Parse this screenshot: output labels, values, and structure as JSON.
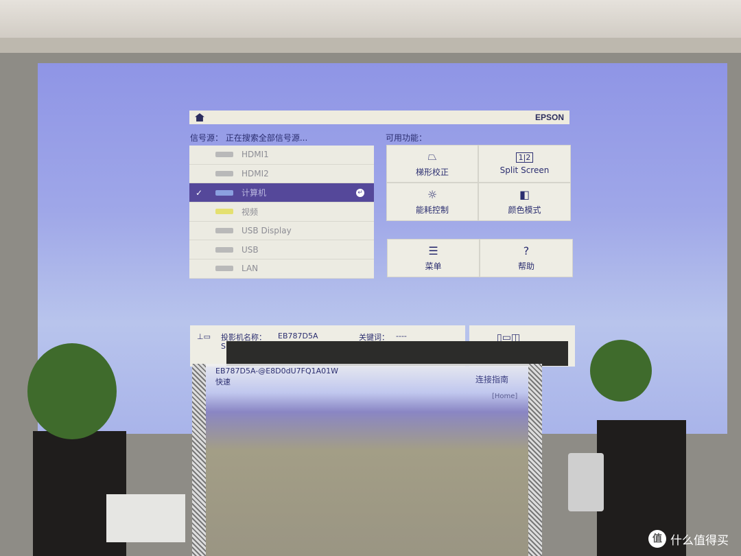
{
  "topbar": {
    "brand": "EPSON",
    "home_icon": "home-icon"
  },
  "source": {
    "header": "信号源： 正在搜索全部信号源...",
    "items": [
      {
        "label": "HDMI1"
      },
      {
        "label": "HDMI2"
      },
      {
        "label": "计算机",
        "selected": true
      },
      {
        "label": "视频"
      },
      {
        "label": "USB Display"
      },
      {
        "label": "USB"
      },
      {
        "label": "LAN"
      }
    ]
  },
  "functions": {
    "header": "可用功能：",
    "tiles": [
      {
        "label": "梯形校正",
        "icon": "keystone-icon"
      },
      {
        "label": "Split Screen",
        "icon": "split-screen-icon"
      },
      {
        "label": "能耗控制",
        "icon": "brightness-icon"
      },
      {
        "label": "颜色模式",
        "icon": "color-mode-icon"
      },
      {
        "label": "菜单",
        "icon": "menu-icon"
      },
      {
        "label": "帮助",
        "icon": "help-icon"
      }
    ]
  },
  "network": {
    "name_label": "投影机名称：",
    "name": "EB787D5A",
    "keyword_label": "关键词：",
    "keyword": "----",
    "partial_s": "S",
    "ssid": "EB787D5A-@E8D0dU7FQ1A01W",
    "mode": "快速"
  },
  "guide": {
    "label": "连接指南",
    "home_hint": "[Home]"
  },
  "watermark": {
    "logo": "值",
    "text": "什么值得买"
  }
}
